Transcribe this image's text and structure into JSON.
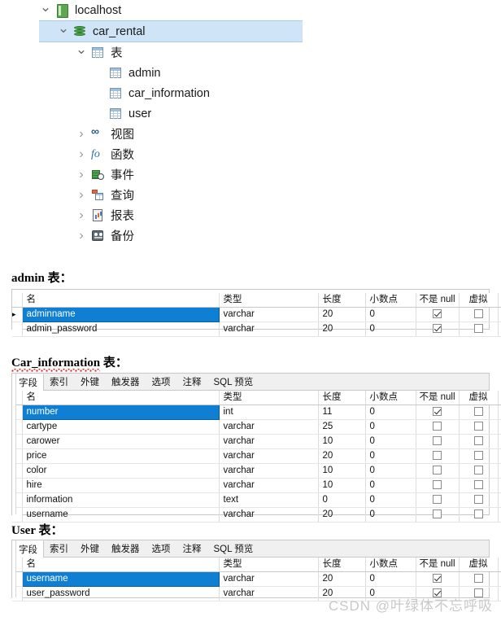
{
  "tree": {
    "nodes": [
      {
        "label": "localhost",
        "icon": "server-icon",
        "indent": 0,
        "chevron": "down",
        "selected": false
      },
      {
        "label": "car_rental",
        "icon": "database-icon",
        "indent": 1,
        "chevron": "down",
        "selected": true
      },
      {
        "label": "表",
        "icon": "table-icon",
        "indent": 2,
        "chevron": "down",
        "selected": false
      },
      {
        "label": "admin",
        "icon": "table-icon",
        "indent": 3,
        "chevron": "none",
        "selected": false
      },
      {
        "label": "car_information",
        "icon": "table-icon",
        "indent": 3,
        "chevron": "none",
        "selected": false
      },
      {
        "label": "user",
        "icon": "table-icon",
        "indent": 3,
        "chevron": "none",
        "selected": false
      },
      {
        "label": "视图",
        "icon": "view-icon",
        "indent": 2,
        "chevron": "right",
        "selected": false
      },
      {
        "label": "函数",
        "icon": "function-icon",
        "indent": 2,
        "chevron": "right",
        "selected": false
      },
      {
        "label": "事件",
        "icon": "event-icon",
        "indent": 2,
        "chevron": "right",
        "selected": false
      },
      {
        "label": "查询",
        "icon": "query-icon",
        "indent": 2,
        "chevron": "right",
        "selected": false
      },
      {
        "label": "报表",
        "icon": "report-icon",
        "indent": 2,
        "chevron": "right",
        "selected": false
      },
      {
        "label": "备份",
        "icon": "backup-icon",
        "indent": 2,
        "chevron": "right",
        "selected": false
      }
    ]
  },
  "columns": {
    "name": "名",
    "type": "类型",
    "length": "长度",
    "decimals": "小数点",
    "not_null": "不是 null",
    "virtual": "虚拟",
    "key": ""
  },
  "tabs": [
    "字段",
    "索引",
    "外键",
    "触发器",
    "选项",
    "注释",
    "SQL 预览"
  ],
  "active_tab": "字段",
  "sections": {
    "admin": {
      "heading": "admin 表：",
      "heading_plain": "admin",
      "heading_suffix": " 表：",
      "spellcheck": false,
      "has_tabs": false,
      "rows": [
        {
          "name": "adminname",
          "type": "varchar",
          "length": "20",
          "decimals": "0",
          "not_null": true,
          "virtual": false,
          "key": "1",
          "selected": true
        },
        {
          "name": "admin_password",
          "type": "varchar",
          "length": "20",
          "decimals": "0",
          "not_null": true,
          "virtual": false,
          "key": "",
          "selected": false
        }
      ]
    },
    "car_information": {
      "heading": "Car_information 表：",
      "heading_plain": "Car_information",
      "heading_suffix": " 表：",
      "spellcheck": true,
      "has_tabs": true,
      "rows": [
        {
          "name": "number",
          "type": "int",
          "length": "11",
          "decimals": "0",
          "not_null": true,
          "virtual": false,
          "key": "1",
          "selected": true
        },
        {
          "name": "cartype",
          "type": "varchar",
          "length": "25",
          "decimals": "0",
          "not_null": false,
          "virtual": false,
          "key": "",
          "selected": false
        },
        {
          "name": "carower",
          "type": "varchar",
          "length": "10",
          "decimals": "0",
          "not_null": false,
          "virtual": false,
          "key": "",
          "selected": false
        },
        {
          "name": "price",
          "type": "varchar",
          "length": "20",
          "decimals": "0",
          "not_null": false,
          "virtual": false,
          "key": "",
          "selected": false
        },
        {
          "name": "color",
          "type": "varchar",
          "length": "10",
          "decimals": "0",
          "not_null": false,
          "virtual": false,
          "key": "",
          "selected": false
        },
        {
          "name": "hire",
          "type": "varchar",
          "length": "10",
          "decimals": "0",
          "not_null": false,
          "virtual": false,
          "key": "",
          "selected": false
        },
        {
          "name": "information",
          "type": "text",
          "length": "0",
          "decimals": "0",
          "not_null": false,
          "virtual": false,
          "key": "",
          "selected": false
        },
        {
          "name": "username",
          "type": "varchar",
          "length": "20",
          "decimals": "0",
          "not_null": false,
          "virtual": false,
          "key": "",
          "selected": false
        }
      ]
    },
    "user": {
      "heading": "User 表：",
      "heading_plain": "User",
      "heading_suffix": " 表：",
      "spellcheck": false,
      "has_tabs": true,
      "rows": [
        {
          "name": "username",
          "type": "varchar",
          "length": "20",
          "decimals": "0",
          "not_null": true,
          "virtual": false,
          "key": "1",
          "selected": true
        },
        {
          "name": "user_password",
          "type": "varchar",
          "length": "20",
          "decimals": "0",
          "not_null": true,
          "virtual": false,
          "key": "",
          "selected": false
        }
      ]
    }
  },
  "watermark": "CSDN @叶绿体不忘呼吸",
  "colors": {
    "selection_blue": "#0f7fd4",
    "tree_selection": "#cfe5f7",
    "key_gold": "#e8ae12",
    "db_green": "#46a046",
    "spell_red": "#e02020"
  }
}
